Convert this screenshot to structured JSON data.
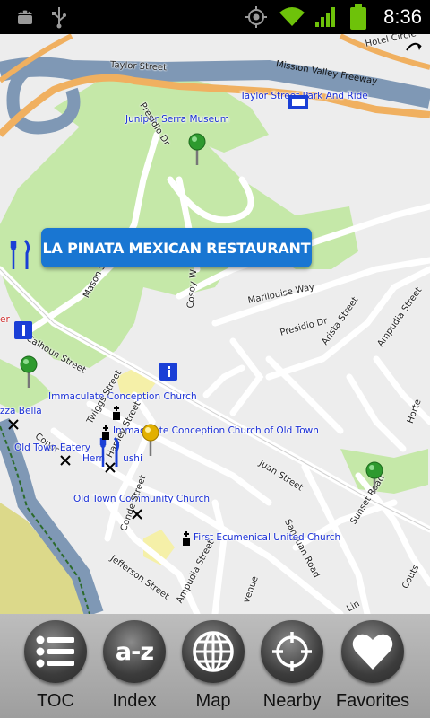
{
  "status_bar": {
    "time": "8:36",
    "icons": [
      "android-debug-icon",
      "usb-icon",
      "gps-icon",
      "wifi-icon",
      "signal-icon",
      "battery-icon"
    ]
  },
  "map": {
    "callout": {
      "title": "LA PINATA MEXICAN RESTAURANT"
    },
    "poi_labels": {
      "juniper_serra_museum": "Juniper Serra Museum",
      "taylor_street_park_ride": "Taylor Street Park And Ride",
      "immaculate_conception_church": "Immaculate Conception Church",
      "immaculate_conception_church_old_town": "Immaculate Conception Church of Old Town",
      "old_town_eatery": "Old Town Eatery",
      "hernando_sushi": "Hern      ushi",
      "old_town_community_church": "Old Town Community Church",
      "first_ecumenical_united_church": "First Ecumenical United Church",
      "pizza_bella": "zza Bella",
      "partial_red": "er"
    },
    "street_labels": {
      "taylor_street": "Taylor Street",
      "mission_valley_freeway": "Mission Valley Freeway",
      "hotel_circle": "Hotel Circle",
      "presidio_drive_top": "Presidio Dr",
      "mason_street": "Mason Street",
      "calhoun_street": "Calhoun Street",
      "twiggs_street": "Twiggs Street",
      "harney_street": "Harney Street",
      "juan_street": "Juan Street",
      "marilouise_way": "Marilouise Way",
      "presidio_drive_mid": "Presidio Dr",
      "arista_street": "Arista Street",
      "ampudia_street_right": "Ampudia Street",
      "ampudia_street_bottom": "Ampudia Street",
      "san_juan_road": "San Juan Road",
      "sunset_road": "Sunset Road",
      "conde_street": "Conde Street",
      "congress_street": "Congr",
      "jefferson_street": "Jefferson Street",
      "cosoy_way": "Cosoy W",
      "hortensia": "Horte",
      "avenue": "venue",
      "linwood": "Lin",
      "couts": "Couts"
    }
  },
  "toolbar": {
    "buttons": [
      {
        "id": "toc",
        "label": "TOC",
        "icon": "list-icon"
      },
      {
        "id": "index",
        "label": "Index",
        "icon": "a-z-icon",
        "glyph": "a-z"
      },
      {
        "id": "map",
        "label": "Map",
        "icon": "globe-icon"
      },
      {
        "id": "nearby",
        "label": "Nearby",
        "icon": "crosshair-icon"
      },
      {
        "id": "favorites",
        "label": "Favorites",
        "icon": "heart-icon"
      }
    ]
  },
  "colors": {
    "freeway": "#7f98b5",
    "arterial": "#f0b060",
    "park": "#c5e8a8",
    "callout": "#1976d2",
    "poi_text": "#1a2fd6"
  }
}
